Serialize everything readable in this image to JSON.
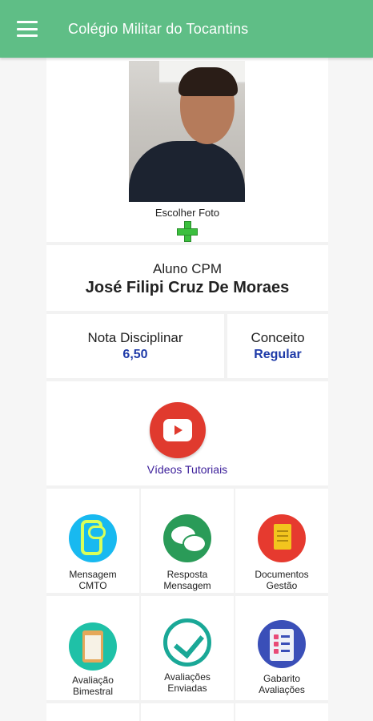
{
  "app": {
    "title": "Colégio Militar do Tocantins",
    "menu_icon": "hamburger-menu-icon"
  },
  "profile": {
    "photo_alt": "",
    "choose_photo_label": "Escolher Foto",
    "add_icon": "plus-icon"
  },
  "student": {
    "role": "Aluno CPM",
    "name": "José Filipi Cruz De Moraes"
  },
  "grades": {
    "discipline_label": "Nota Disciplinar",
    "discipline_value": "6,50",
    "concept_label": "Conceito",
    "concept_value": "Regular"
  },
  "videos": {
    "label": "Vídeos Tutoriais",
    "icon": "youtube-play-icon"
  },
  "menu_tiles": [
    {
      "label_line1": "Mensagem",
      "label_line2": "CMTO",
      "icon": "message-phone-icon"
    },
    {
      "label_line1": "Resposta",
      "label_line2": "Mensagem",
      "icon": "chat-bubbles-icon"
    },
    {
      "label_line1": "Documentos",
      "label_line2": "Gestão",
      "icon": "documents-icon"
    },
    {
      "label_line1": "Avaliação",
      "label_line2": "Bimestral",
      "icon": "clipboard-icon"
    },
    {
      "label_line1": "Avaliações",
      "label_line2": "Enviadas",
      "icon": "checkmark-icon"
    },
    {
      "label_line1": "Gabarito",
      "label_line2": "Avaliações",
      "icon": "checklist-icon"
    }
  ],
  "colors": {
    "primary": "#5fbe86",
    "value_blue": "#1e3aa8",
    "link_purple": "#3b1e9a"
  }
}
